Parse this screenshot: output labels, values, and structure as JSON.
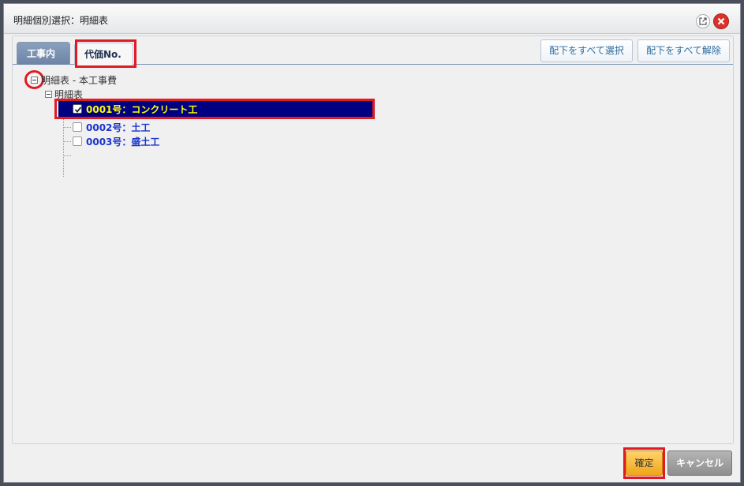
{
  "window": {
    "title": "明細個別選択：明細表"
  },
  "tabs": [
    {
      "label": "工事内訳"
    },
    {
      "label": "代価No."
    }
  ],
  "toolbar": {
    "select_all": "配下をすべて選択",
    "clear_all": "配下をすべて解除"
  },
  "tree": {
    "root_label": "明細表 - 本工事費",
    "child_label": "明細表",
    "items": [
      {
        "label": "0001号：コンクリート工",
        "checked": true,
        "selected": true
      },
      {
        "label": "0002号：土工",
        "checked": false,
        "selected": false
      },
      {
        "label": "0003号：盛土工",
        "checked": false,
        "selected": false
      }
    ]
  },
  "footer": {
    "ok": "確定",
    "cancel": "キャンセル"
  },
  "colors": {
    "selection_bg": "#000080",
    "selection_text": "#ffff00",
    "item_text": "#1a33cc",
    "highlight": "#e01b24"
  }
}
